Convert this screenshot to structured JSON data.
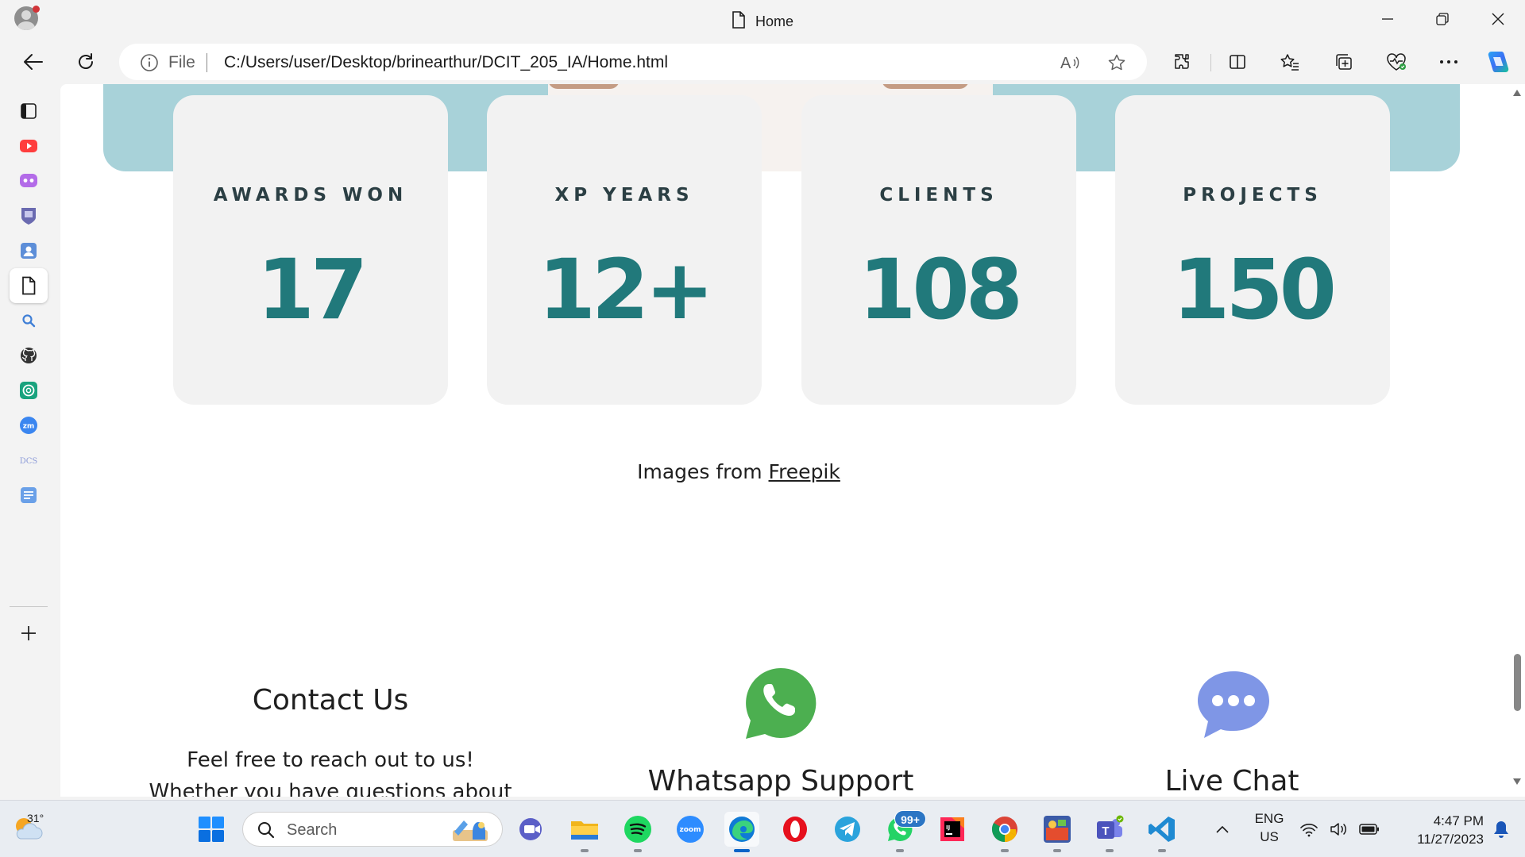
{
  "window": {
    "title": "Home"
  },
  "address_bar": {
    "scheme_label": "File",
    "url": "C:/Users/user/Desktop/brinearthur/DCIT_205_IA/Home.html"
  },
  "sidebar": {
    "items": [
      "youtube-icon",
      "copilot-icon",
      "university-icon",
      "contact-card-icon",
      "document-icon",
      "search-icon",
      "github-icon",
      "chatgpt-icon",
      "zoom-icon",
      "dcit-icon",
      "notes-icon"
    ]
  },
  "page": {
    "stats": [
      {
        "label": "AWARDS WON",
        "value": "17"
      },
      {
        "label": "XP YEARS",
        "value": "12+"
      },
      {
        "label": "CLIENTS",
        "value": "108"
      },
      {
        "label": "PROJECTS",
        "value": "150"
      }
    ],
    "credit_prefix": "Images from",
    "credit_link": "Freepik",
    "contact": {
      "title": "Contact Us",
      "text": "Feel free to reach out to us! Whether you have questions about our"
    },
    "whatsapp": {
      "title": "Whatsapp Support"
    },
    "live_chat": {
      "title": "Live Chat"
    },
    "colors": {
      "accent": "#21797b",
      "label": "#2b3f44",
      "card_bg": "#f2f2f2",
      "hero_band": "#a8d2d9",
      "whatsapp_green": "#4caf50",
      "chat_blue": "#7f96e6"
    }
  },
  "taskbar": {
    "weather_temp": "31°",
    "search_placeholder": "Search",
    "whatsapp_badge": "99+",
    "language": "ENG",
    "region": "US",
    "time": "4:47 PM",
    "date": "11/27/2023"
  }
}
